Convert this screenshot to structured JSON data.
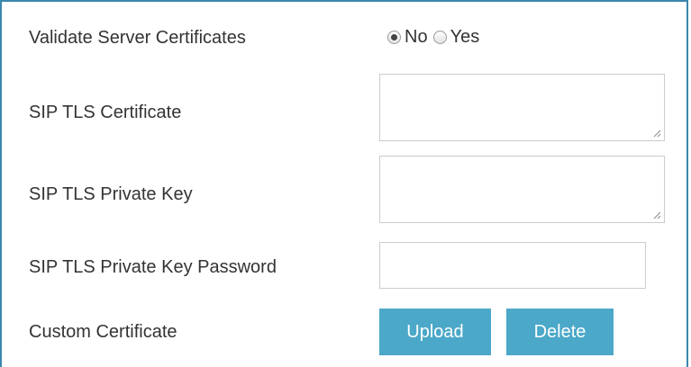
{
  "form": {
    "validate_server_certificates": {
      "label": "Validate Server Certificates",
      "options": [
        "No",
        "Yes"
      ],
      "selected": "No"
    },
    "sip_tls_certificate": {
      "label": "SIP TLS Certificate",
      "value": ""
    },
    "sip_tls_private_key": {
      "label": "SIP TLS Private Key",
      "value": ""
    },
    "sip_tls_private_key_password": {
      "label": "SIP TLS Private Key Password",
      "value": ""
    },
    "custom_certificate": {
      "label": "Custom Certificate",
      "upload_label": "Upload",
      "delete_label": "Delete"
    }
  },
  "colors": {
    "border": "#3a87ad",
    "button": "#4ba8c8",
    "text": "#333333"
  }
}
